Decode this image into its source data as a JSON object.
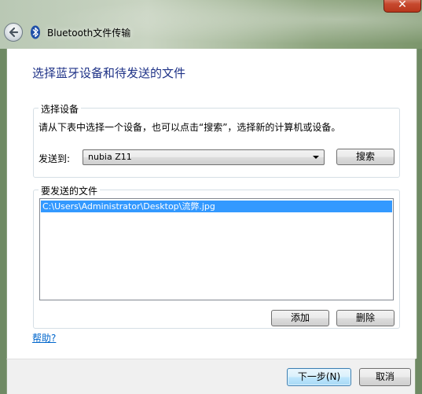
{
  "window": {
    "title": "Bluetooth文件传输",
    "close_label": "✕"
  },
  "heading": "选择蓝牙设备和待发送的文件",
  "device_group": {
    "legend": "选择设备",
    "instruction": "请从下表中选择一个设备，也可以点击“搜索”，选择新的计算机或设备。",
    "send_to_label": "发送到:",
    "selected_device": "nubia Z11",
    "search_button": "搜索"
  },
  "files_group": {
    "legend": "要发送的文件",
    "files": [
      "C:\\Users\\Administrator\\Desktop\\流弊.jpg"
    ],
    "add_button": "添加",
    "delete_button": "删除"
  },
  "help_link": "帮助?",
  "footer": {
    "next_button": "下一步(N)",
    "cancel_button": "取消"
  },
  "icons": {
    "back": "back-arrow-icon",
    "bluetooth": "bluetooth-icon",
    "dropdown": "chevron-down-icon"
  },
  "colors": {
    "heading": "#1e3287",
    "selection": "#3399ff",
    "link": "#0066cc",
    "close": "#c7492e"
  }
}
